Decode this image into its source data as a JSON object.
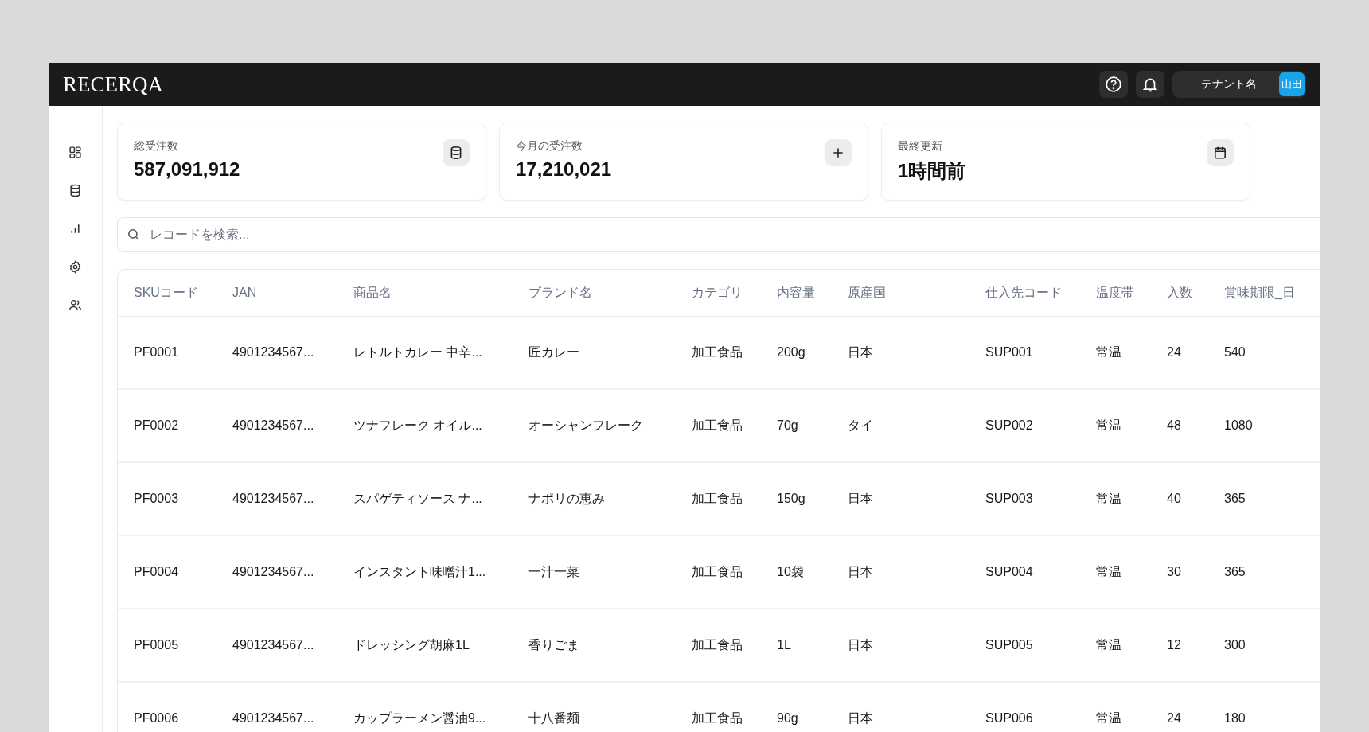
{
  "header": {
    "logo": "RECERQA",
    "tenant": "テナント名",
    "avatar": "山田"
  },
  "sidebar": {
    "items": [
      {
        "kind": "grid",
        "selected": false
      },
      {
        "kind": "database",
        "selected": false
      },
      {
        "kind": "chart",
        "selected": false
      },
      {
        "kind": "settings",
        "selected": false
      },
      {
        "kind": "users",
        "selected": false
      }
    ]
  },
  "stats": [
    {
      "label": "総受注数",
      "value": "587,091,912",
      "kind": "database"
    },
    {
      "label": "今月の受注数",
      "value": "17,210,021",
      "kind": "plus"
    },
    {
      "label": "最終更新",
      "value": "1時間前",
      "kind": "calendar"
    }
  ],
  "search": {
    "placeholder": "レコードを検索..."
  },
  "table": {
    "columns": [
      "SKUコード",
      "JAN",
      "商品名",
      "ブランド名",
      "カテゴリ",
      "内容量",
      "原産国",
      "仕入先コード",
      "温度帯",
      "入数",
      "賞味期限_日"
    ],
    "rows": [
      [
        "PF0001",
        "4901234567...",
        "レトルトカレー 中辛...",
        "匠カレー",
        "加工食品",
        "200g",
        "日本",
        "SUP001",
        "常温",
        "24",
        "540"
      ],
      [
        "PF0002",
        "4901234567...",
        "ツナフレーク オイル...",
        "オーシャンフレーク",
        "加工食品",
        "70g",
        "タイ",
        "SUP002",
        "常温",
        "48",
        "1080"
      ],
      [
        "PF0003",
        "4901234567...",
        "スパゲティソース ナ...",
        "ナポリの恵み",
        "加工食品",
        "150g",
        "日本",
        "SUP003",
        "常温",
        "40",
        "365"
      ],
      [
        "PF0004",
        "4901234567...",
        "インスタント味噌汁1...",
        "一汁一菜",
        "加工食品",
        "10袋",
        "日本",
        "SUP004",
        "常温",
        "30",
        "365"
      ],
      [
        "PF0005",
        "4901234567...",
        "ドレッシング胡麻1L",
        "香りごま",
        "加工食品",
        "1L",
        "日本",
        "SUP005",
        "常温",
        "12",
        "300"
      ],
      [
        "PF0006",
        "4901234567...",
        "カップラーメン醤油9...",
        "十八番麺",
        "加工食品",
        "90g",
        "日本",
        "SUP006",
        "常温",
        "24",
        "180"
      ]
    ]
  }
}
